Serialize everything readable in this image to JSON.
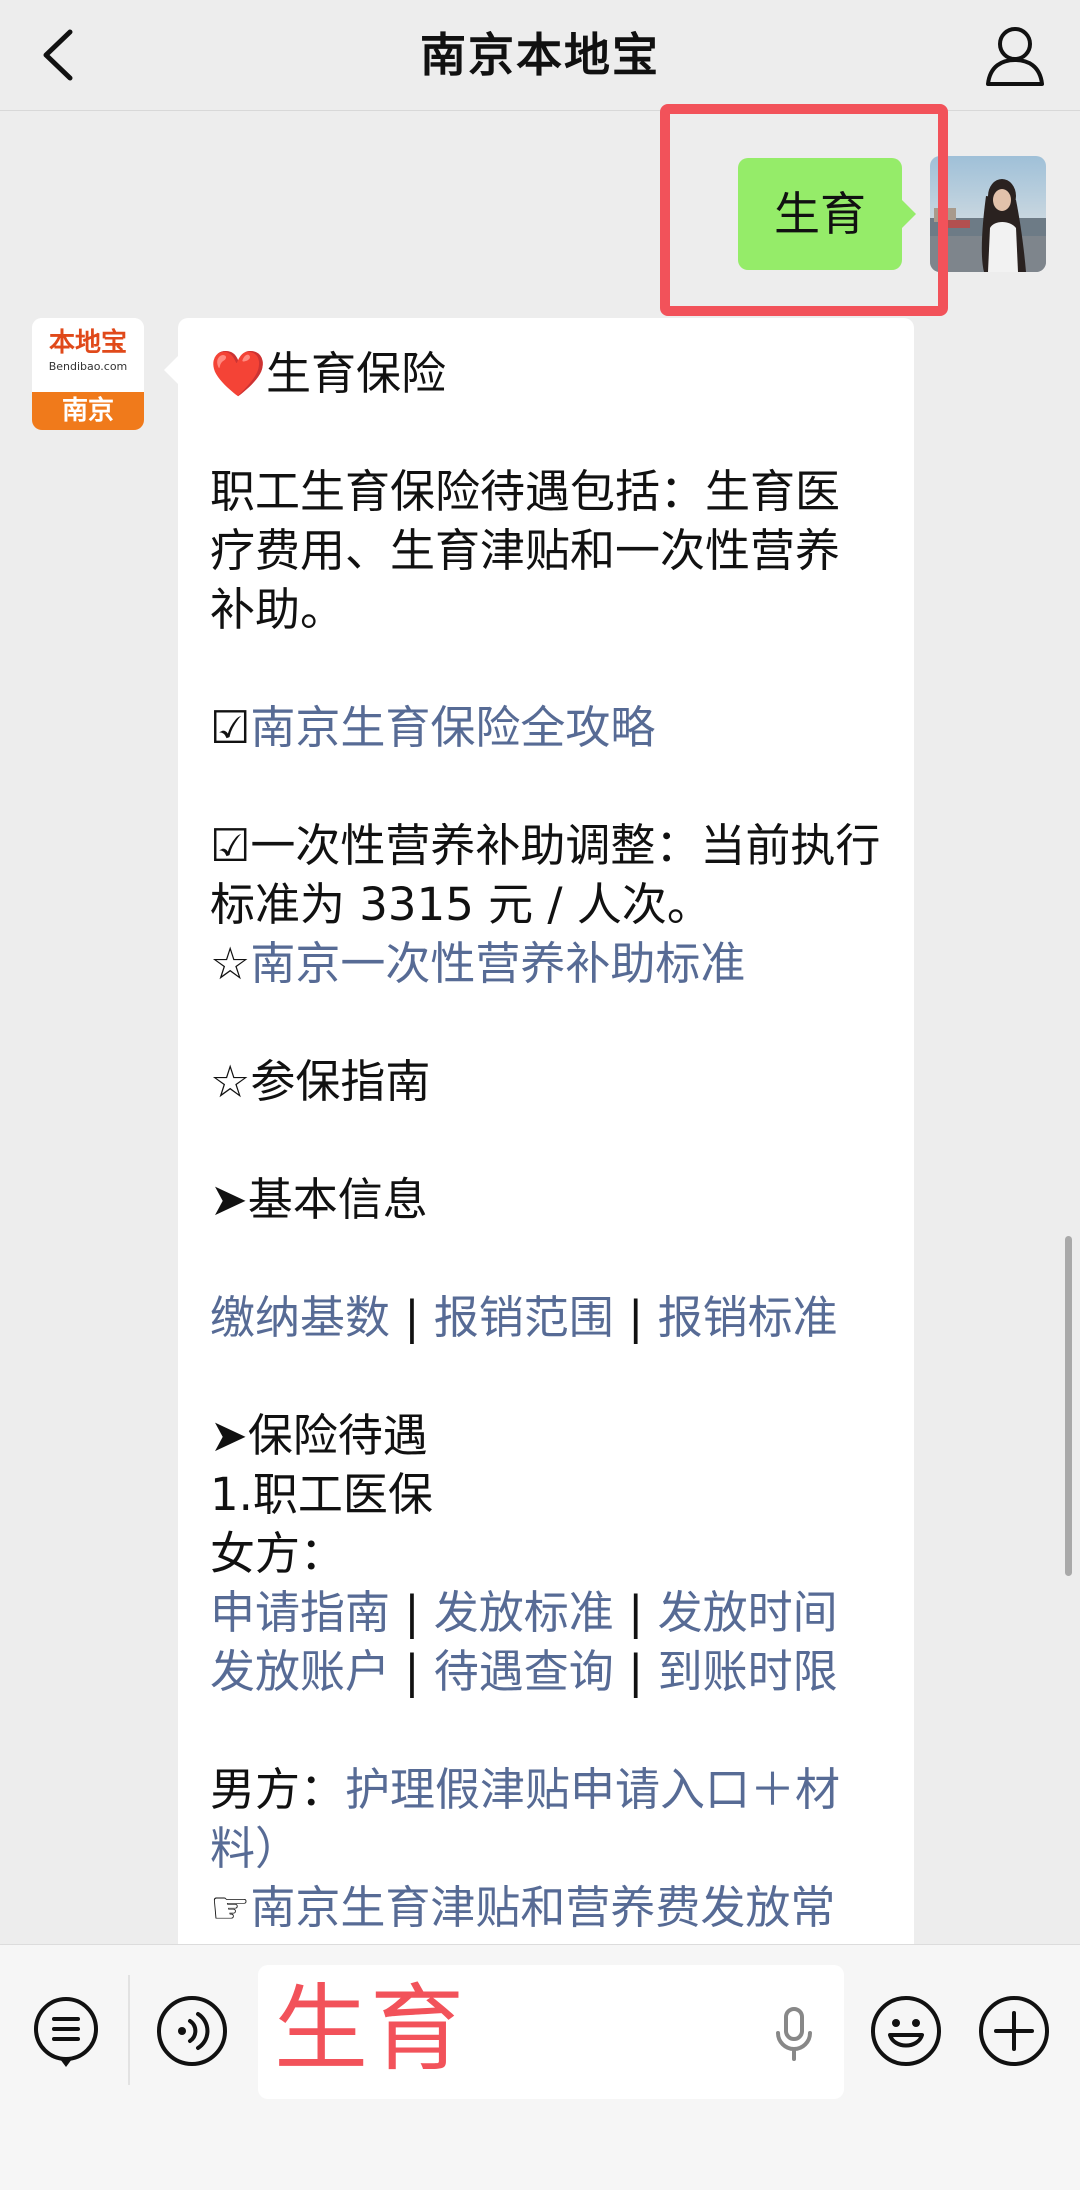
{
  "header": {
    "title": "南京本地宝",
    "back_icon": "chevron-left-icon",
    "profile_icon": "user-icon"
  },
  "outgoing": {
    "text": "生育",
    "bubble_color": "#95ec69",
    "highlight_color": "#f2525a"
  },
  "bot": {
    "logo_name": "本地宝",
    "logo_url": "Bendibao.com",
    "logo_city": "南京",
    "logo_accent": "#f07a1b"
  },
  "reply": {
    "heart": "❤️",
    "heading": "生育保险",
    "intro": "职工生育保险待遇包括：生育医疗费用、生育津贴和一次性营养补助。",
    "check1": "☑",
    "link_guide": "南京生育保险全攻略",
    "check2": "☑",
    "adjust_text": "一次性营养补助调整：当前执行标准为 3315 元 / 人次。",
    "star1": "☆",
    "link_nutrition": "南京一次性营养补助标准",
    "star2": "☆",
    "enroll_heading": "参保指南",
    "arrow1": "➤",
    "basic_info": "基本信息",
    "basic_links": [
      "缴纳基数",
      "报销范围",
      "报销标准"
    ],
    "separator": " | ",
    "arrow2": "➤",
    "benefits": "保险待遇",
    "medical": "1.职工医保",
    "female_label": "女方：",
    "female_links_row1": [
      "申请指南",
      "发放标准",
      "发放时间"
    ],
    "female_links_row2": [
      "发放账户",
      "待遇查询",
      "到账时限"
    ],
    "male_label": "男方：",
    "male_link": "护理假津贴申请入口＋材料）",
    "pointer": "☞",
    "faq_link": "南京生育津贴和营养费发放常",
    "link_color": "#576b95"
  },
  "input": {
    "value": "生育",
    "menu_icon": "menu-list-icon",
    "voice_icon": "voice-icon",
    "mic_icon": "microphone-icon",
    "emoji_icon": "emoji-icon",
    "plus_icon": "plus-icon"
  }
}
